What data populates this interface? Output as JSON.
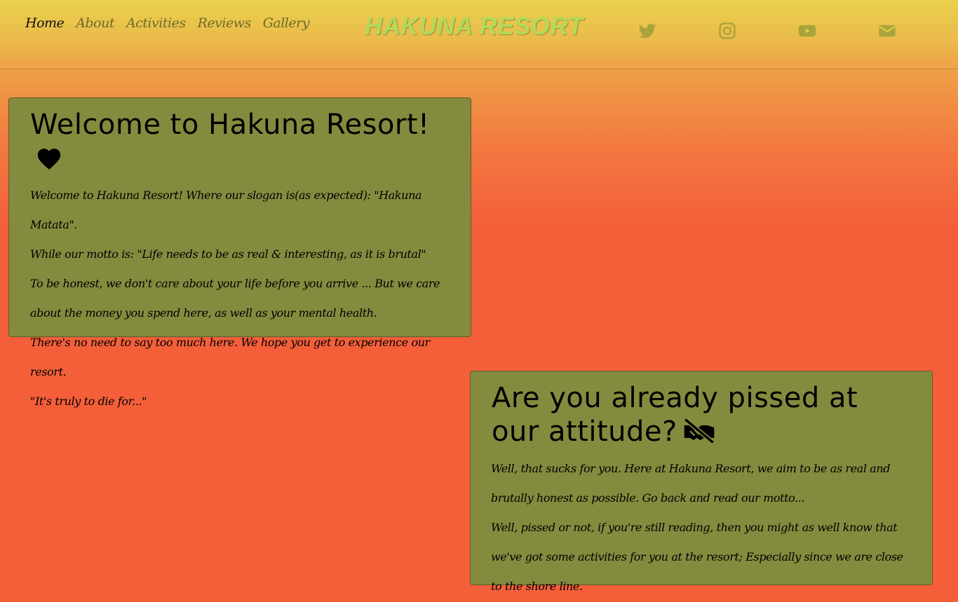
{
  "nav": {
    "links": [
      "Home",
      "About",
      "Activities",
      "Reviews",
      "Gallery"
    ],
    "active": "Home",
    "brand": "HAKUNA RESORT",
    "social_icons": [
      "twitter-icon",
      "instagram-icon",
      "youtube-icon",
      "envelope-icon"
    ]
  },
  "card_welcome": {
    "title": "Welcome to Hakuna Resort!",
    "title_icon": "heart-icon",
    "lines": [
      "Welcome to Hakuna Resort! Where our slogan is(as expected): \"Hakuna Matata\".",
      "While our motto is: \"Life needs to be as real & interesting, as it is brutal\"",
      "To be honest, we don't care about your life before you arrive ... But we care about the money you spend here, as well as your mental health.",
      "There's no need to say too much here. We hope you get to experience our resort.",
      "\"It's truly to die for...\""
    ]
  },
  "card_attitude": {
    "title": "Are you already pissed at our attitude?",
    "title_icon": "handshake-slash-icon",
    "lines": [
      "Well, that sucks for you. Here at Hakuna Resort, we aim to be as real and brutally honest as possible. Go back and read our motto...",
      "Well, pissed or not, if you're still reading, then you might as well know that we've got some activities for you at the resort; Especially since we are close to the shore line."
    ]
  },
  "colors": {
    "card_bg": "#858b3e",
    "brand": "#b4d95a",
    "icon": "#a9a33c",
    "nav_text": "#6e6a2c"
  }
}
